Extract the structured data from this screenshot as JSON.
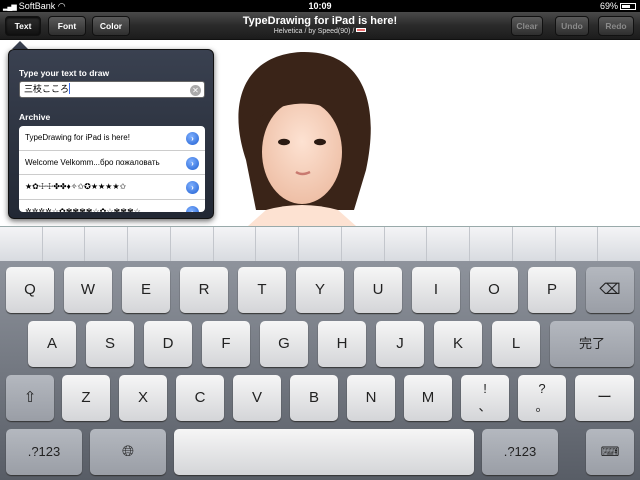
{
  "statusbar": {
    "carrier": "SoftBank",
    "time": "10:09",
    "battery": "69%",
    "battery_fraction": 0.69
  },
  "toolbar": {
    "text_label": "Text",
    "font_label": "Font",
    "color_label": "Color",
    "title": "TypeDrawing for iPad is here!",
    "subtitle": "Helvetica / by Speed(90) /",
    "clear_label": "Clear",
    "undo_label": "Undo",
    "redo_label": "Redo"
  },
  "popover": {
    "input_label": "Type your text to draw",
    "input_value": "三枝こころ",
    "archive_label": "Archive",
    "archive_items": [
      "TypeDrawing for iPad is here!",
      "Welcome Velkomm...бро пожаловать",
      "★✿☩☩✤✤♦✧✩✪★★★★✩",
      "✲✲✲✲☆✿✾✾✾✾☆✿☆✾✾✾☆"
    ]
  },
  "keyboard": {
    "row1": [
      "Q",
      "W",
      "E",
      "R",
      "T",
      "Y",
      "U",
      "I",
      "O",
      "P"
    ],
    "row2": [
      "A",
      "S",
      "D",
      "F",
      "G",
      "H",
      "J",
      "K",
      "L"
    ],
    "done_label": "完了",
    "row3": [
      "Z",
      "X",
      "C",
      "V",
      "B",
      "N",
      "M"
    ],
    "excl_top": "!",
    "excl_bottom": "、",
    "ques_top": "?",
    "ques_bottom": "。",
    "dash_label": "ー",
    "num_label": ".?123"
  }
}
